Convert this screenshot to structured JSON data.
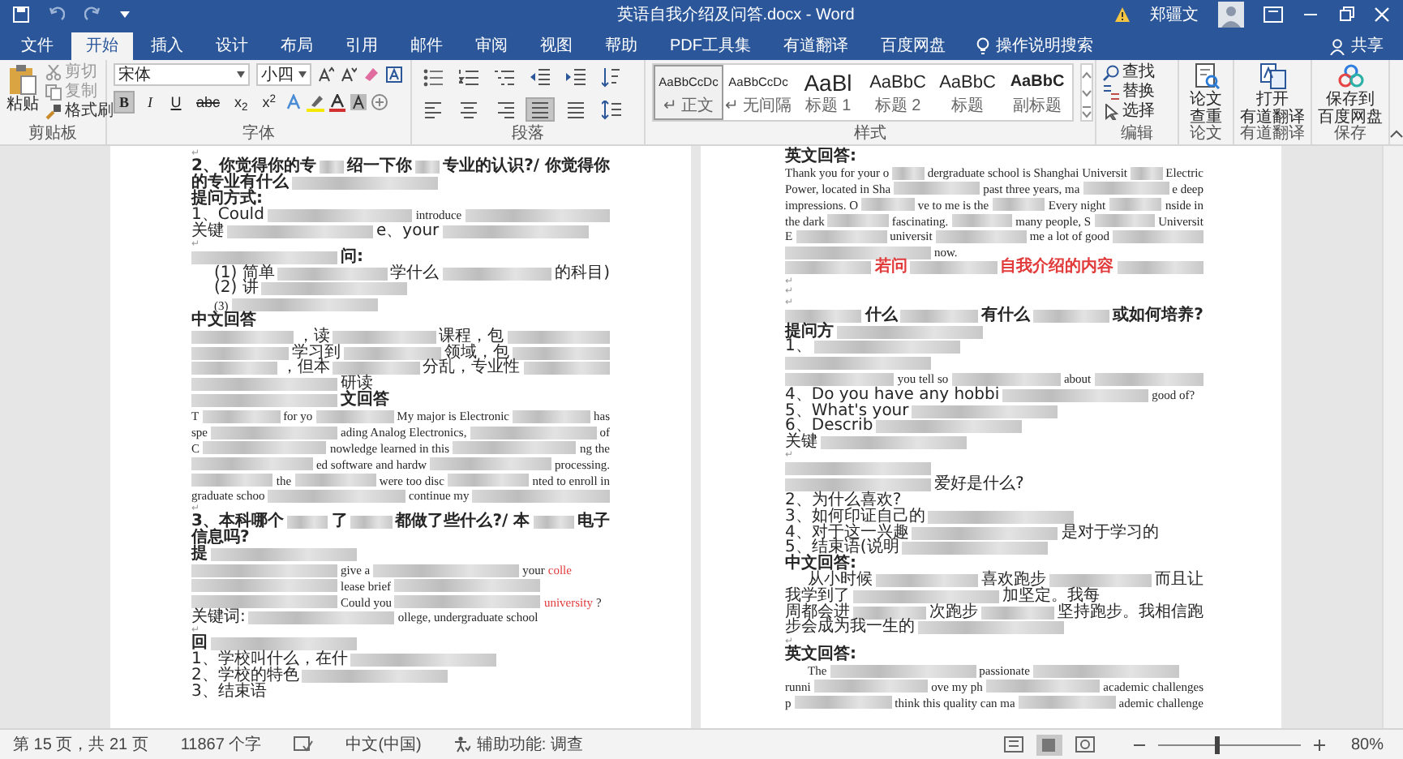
{
  "title_bar": {
    "title": "英语自我介绍及问答.docx - Word",
    "user": "郑疆文"
  },
  "tabs": [
    {
      "label": "文件",
      "selected": false
    },
    {
      "label": "开始",
      "selected": true
    },
    {
      "label": "插入",
      "selected": false
    },
    {
      "label": "设计",
      "selected": false
    },
    {
      "label": "布局",
      "selected": false
    },
    {
      "label": "引用",
      "selected": false
    },
    {
      "label": "邮件",
      "selected": false
    },
    {
      "label": "审阅",
      "selected": false
    },
    {
      "label": "视图",
      "selected": false
    },
    {
      "label": "帮助",
      "selected": false
    },
    {
      "label": "PDF工具集",
      "selected": false
    },
    {
      "label": "有道翻译",
      "selected": false
    },
    {
      "label": "百度网盘",
      "selected": false
    }
  ],
  "tell_me": "操作说明搜索",
  "share": "共享",
  "clipboard": {
    "paste": "粘贴",
    "cut": "剪切",
    "copy": "复制",
    "format_painter": "格式刷",
    "label": "剪贴板"
  },
  "font": {
    "label": "字体",
    "font_name": "宋体",
    "font_size": "小四",
    "buttons": [
      {
        "text": "B",
        "selected": true
      },
      {
        "text": "I",
        "selected": false
      },
      {
        "text": "U",
        "selected": false
      },
      {
        "text": "abc",
        "selected": false
      },
      {
        "text": "x$_{2}$",
        "selected": false
      },
      {
        "text": "x$^{2}$",
        "selected": false
      }
    ]
  },
  "paragraph": {
    "label": "段落",
    "buttons": [
      {
        "kind": "bullets",
        "selected": false
      },
      {
        "kind": "numbering",
        "selected": false
      },
      {
        "kind": "multilevel",
        "selected": false
      },
      {
        "kind": "outdent",
        "selected": false
      },
      {
        "kind": "indent",
        "selected": false
      },
      {
        "kind": "sort",
        "selected": false
      },
      {
        "kind": "align-left",
        "selected": false
      },
      {
        "kind": "center",
        "selected": false
      },
      {
        "kind": "align-right",
        "selected": false
      },
      {
        "kind": "justify",
        "selected": true
      },
      {
        "kind": "distributed",
        "selected": false
      },
      {
        "kind": "line-spacing",
        "selected": false
      }
    ]
  },
  "styles": {
    "label": "样式",
    "items": [
      {
        "preview": "AaBbCcDc",
        "name": "↵ 正文",
        "kind": "normal",
        "selected": true
      },
      {
        "preview": "AaBbCcDc",
        "name": "↵ 无间隔",
        "kind": "normal",
        "selected": false
      },
      {
        "preview": "AaBl",
        "name": "标题 1",
        "kind": "large",
        "selected": false
      },
      {
        "preview": "AaBbC",
        "name": "标题 2",
        "kind": "medium",
        "selected": false
      },
      {
        "preview": "AaBbC",
        "name": "标题",
        "kind": "medium",
        "selected": false
      },
      {
        "preview": "AaBbC",
        "name": "副标题",
        "kind": "bold",
        "selected": false
      }
    ]
  },
  "editing": {
    "label": "编辑",
    "find": "查找",
    "replace": "替换",
    "select": "选择"
  },
  "paper": {
    "label": "论文",
    "button": [
      "论文",
      "查重"
    ]
  },
  "youdao": {
    "label": "有道翻译",
    "button": [
      "打开",
      "有道翻译"
    ]
  },
  "save": {
    "label": "保存",
    "button": [
      "保存到",
      "百度网盘"
    ]
  },
  "pages": [
    {
      "lines": [
        {
          "kind": "mark",
          "parts": [
            {
              "kind": "text",
              "text": "↵"
            }
          ]
        },
        {
          "kind": "heading",
          "parts": [
            {
              "kind": "text",
              "text": "2、你觉得你的专"
            },
            {
              "kind": "blur"
            },
            {
              "kind": "text",
              "text": "绍一下你"
            },
            {
              "kind": "blur"
            },
            {
              "kind": "text",
              "text": "专业的认识?/ 你觉得你"
            }
          ]
        },
        {
          "kind": "heading",
          "parts": [
            {
              "kind": "text",
              "text": "的专业有什么"
            },
            {
              "kind": "blur"
            }
          ]
        },
        {
          "kind": "heading",
          "parts": [
            {
              "kind": "text",
              "text": "提问方式:"
            }
          ]
        },
        {
          "kind": "body",
          "parts": [
            {
              "kind": "text",
              "text": "1、Could"
            },
            {
              "kind": "blur"
            },
            {
              "kind": "text",
              "text": "introduce"
            },
            {
              "kind": "blur"
            }
          ]
        },
        {
          "kind": "body",
          "parts": [
            {
              "kind": "text",
              "text": "关键"
            },
            {
              "kind": "blur"
            },
            {
              "kind": "text",
              "text": "e、your"
            },
            {
              "kind": "blur"
            }
          ]
        },
        {
          "kind": "mark",
          "parts": [
            {
              "kind": "text",
              "text": "↵"
            }
          ]
        },
        {
          "kind": "heading",
          "parts": [
            {
              "kind": "blur"
            },
            {
              "kind": "text",
              "text": "问:"
            }
          ]
        },
        {
          "kind": "indented",
          "parts": [
            {
              "kind": "text",
              "text": "(1) 简单"
            },
            {
              "kind": "blur"
            },
            {
              "kind": "text",
              "text": "学什么"
            },
            {
              "kind": "blur"
            },
            {
              "kind": "text",
              "text": "的科目)"
            }
          ]
        },
        {
          "kind": "indented",
          "parts": [
            {
              "kind": "text",
              "text": "(2) 讲"
            },
            {
              "kind": "blur"
            }
          ]
        },
        {
          "kind": "indented",
          "parts": [
            {
              "kind": "text",
              "text": "(3)"
            },
            {
              "kind": "blur"
            }
          ]
        },
        {
          "kind": "heading",
          "parts": [
            {
              "kind": "text",
              "text": "中文回答"
            }
          ]
        },
        {
          "kind": "body",
          "parts": [
            {
              "kind": "blur"
            },
            {
              "kind": "text",
              "text": "，读"
            },
            {
              "kind": "blur"
            },
            {
              "kind": "text",
              "text": "课程，包"
            },
            {
              "kind": "blur"
            }
          ]
        },
        {
          "kind": "body",
          "parts": [
            {
              "kind": "blur"
            },
            {
              "kind": "text",
              "text": "学习到"
            },
            {
              "kind": "blur"
            },
            {
              "kind": "text",
              "text": "领域，包"
            },
            {
              "kind": "blur"
            }
          ]
        },
        {
          "kind": "body",
          "parts": [
            {
              "kind": "blur"
            },
            {
              "kind": "text",
              "text": "，但本"
            },
            {
              "kind": "blur"
            },
            {
              "kind": "text",
              "text": "分乱，专业性"
            },
            {
              "kind": "blur"
            }
          ]
        },
        {
          "kind": "body",
          "parts": [
            {
              "kind": "blur"
            },
            {
              "kind": "text",
              "text": "研读"
            }
          ]
        },
        {
          "kind": "heading",
          "parts": [
            {
              "kind": "blur"
            },
            {
              "kind": "text",
              "text": "文回答"
            }
          ]
        },
        {
          "kind": "body",
          "parts": [
            {
              "kind": "text",
              "text": "T"
            },
            {
              "kind": "blur"
            },
            {
              "kind": "text",
              "text": "for yo"
            },
            {
              "kind": "blur"
            },
            {
              "kind": "text",
              "text": "My major is Electronic"
            },
            {
              "kind": "blur"
            },
            {
              "kind": "text",
              "text": "has"
            }
          ]
        },
        {
          "kind": "body",
          "parts": [
            {
              "kind": "text",
              "text": "spe"
            },
            {
              "kind": "blur"
            },
            {
              "kind": "text",
              "text": "ading Analog Electronics,"
            },
            {
              "kind": "blur"
            },
            {
              "kind": "text",
              "text": "of"
            }
          ]
        },
        {
          "kind": "body",
          "parts": [
            {
              "kind": "text",
              "text": "C"
            },
            {
              "kind": "blur"
            },
            {
              "kind": "text",
              "text": "nowledge learned in this"
            },
            {
              "kind": "blur"
            },
            {
              "kind": "text",
              "text": "ng the"
            }
          ]
        },
        {
          "kind": "body",
          "parts": [
            {
              "kind": "blur"
            },
            {
              "kind": "text",
              "text": "ed software and hardw"
            },
            {
              "kind": "blur"
            },
            {
              "kind": "text",
              "text": "processing."
            }
          ]
        },
        {
          "kind": "body",
          "parts": [
            {
              "kind": "blur"
            },
            {
              "kind": "text",
              "text": "the"
            },
            {
              "kind": "blur"
            },
            {
              "kind": "text",
              "text": "were too disc"
            },
            {
              "kind": "blur"
            },
            {
              "kind": "text",
              "text": "nted to enroll in"
            }
          ]
        },
        {
          "kind": "body",
          "parts": [
            {
              "kind": "text",
              "text": "graduate schoo"
            },
            {
              "kind": "blur"
            },
            {
              "kind": "text",
              "text": "continue my"
            },
            {
              "kind": "blur"
            }
          ]
        },
        {
          "kind": "mark",
          "parts": [
            {
              "kind": "text",
              "text": "↵"
            }
          ]
        },
        {
          "kind": "heading",
          "parts": [
            {
              "kind": "text",
              "text": "3、本科哪个"
            },
            {
              "kind": "blur"
            },
            {
              "kind": "text",
              "text": "了"
            },
            {
              "kind": "blur"
            },
            {
              "kind": "text",
              "text": "都做了些什么?/ 本"
            },
            {
              "kind": "blur"
            },
            {
              "kind": "text",
              "text": "电子"
            }
          ]
        },
        {
          "kind": "heading",
          "parts": [
            {
              "kind": "text",
              "text": "信息吗?"
            }
          ]
        },
        {
          "kind": "heading",
          "parts": [
            {
              "kind": "text",
              "text": "提"
            },
            {
              "kind": "blur"
            }
          ]
        },
        {
          "kind": "body",
          "parts": [
            {
              "kind": "blur"
            },
            {
              "kind": "text",
              "text": "give a"
            },
            {
              "kind": "blur"
            },
            {
              "kind": "text",
              "text": "your"
            },
            {
              "kind": "red",
              "text": "colle"
            }
          ]
        },
        {
          "kind": "body",
          "parts": [
            {
              "kind": "blur"
            },
            {
              "kind": "text",
              "text": "lease brief"
            },
            {
              "kind": "blur"
            }
          ]
        },
        {
          "kind": "body",
          "parts": [
            {
              "kind": "blur"
            },
            {
              "kind": "text",
              "text": "Could you"
            },
            {
              "kind": "blur"
            },
            {
              "kind": "red",
              "text": "university"
            },
            {
              "kind": "text",
              "text": "?"
            }
          ]
        },
        {
          "kind": "body",
          "parts": [
            {
              "kind": "text",
              "text": "关键词:"
            },
            {
              "kind": "blur"
            },
            {
              "kind": "text",
              "text": "ollege, undergraduate school"
            }
          ]
        },
        {
          "kind": "mark",
          "parts": [
            {
              "kind": "text",
              "text": "↵"
            }
          ]
        },
        {
          "kind": "heading",
          "parts": [
            {
              "kind": "text",
              "text": "回"
            },
            {
              "kind": "blur"
            }
          ]
        },
        {
          "kind": "body",
          "parts": [
            {
              "kind": "text",
              "text": "1、学校叫什么，在什"
            },
            {
              "kind": "blur"
            }
          ]
        },
        {
          "kind": "body",
          "parts": [
            {
              "kind": "text",
              "text": "2、学校的特色"
            },
            {
              "kind": "blur"
            }
          ]
        },
        {
          "kind": "body",
          "parts": [
            {
              "kind": "text",
              "text": "3、结束语"
            }
          ]
        }
      ]
    },
    {
      "lines": [
        {
          "kind": "heading",
          "parts": [
            {
              "kind": "text",
              "text": "英文回答:"
            }
          ]
        },
        {
          "kind": "body",
          "parts": [
            {
              "kind": "text",
              "text": "Thank you for your o"
            },
            {
              "kind": "blur"
            },
            {
              "kind": "text",
              "text": "dergraduate school is Shanghai Universit"
            },
            {
              "kind": "blur"
            },
            {
              "kind": "text",
              "text": "Electric"
            }
          ]
        },
        {
          "kind": "body",
          "parts": [
            {
              "kind": "text",
              "text": "Power, located in Sha"
            },
            {
              "kind": "blur"
            },
            {
              "kind": "text",
              "text": "past three years, ma"
            },
            {
              "kind": "blur"
            },
            {
              "kind": "text",
              "text": "e deep"
            }
          ]
        },
        {
          "kind": "body",
          "parts": [
            {
              "kind": "text",
              "text": "impressions. O"
            },
            {
              "kind": "blur"
            },
            {
              "kind": "text",
              "text": "ve to me is the"
            },
            {
              "kind": "blur"
            },
            {
              "kind": "text",
              "text": "Every night"
            },
            {
              "kind": "blur"
            },
            {
              "kind": "text",
              "text": "nside in"
            }
          ]
        },
        {
          "kind": "body",
          "parts": [
            {
              "kind": "text",
              "text": "the dark"
            },
            {
              "kind": "blur"
            },
            {
              "kind": "text",
              "text": "fascinating."
            },
            {
              "kind": "blur"
            },
            {
              "kind": "text",
              "text": "many people, S"
            },
            {
              "kind": "blur"
            },
            {
              "kind": "text",
              "text": "Universit"
            }
          ]
        },
        {
          "kind": "body",
          "parts": [
            {
              "kind": "text",
              "text": "E"
            },
            {
              "kind": "blur"
            },
            {
              "kind": "text",
              "text": "universit"
            },
            {
              "kind": "blur"
            },
            {
              "kind": "text",
              "text": "me a lot of good"
            },
            {
              "kind": "blur"
            }
          ]
        },
        {
          "kind": "body",
          "parts": [
            {
              "kind": "blur"
            },
            {
              "kind": "text",
              "text": "now."
            }
          ]
        },
        {
          "kind": "heading",
          "parts": [
            {
              "kind": "blur"
            },
            {
              "kind": "red",
              "text": "若问"
            },
            {
              "kind": "blur"
            },
            {
              "kind": "red",
              "text": "自我介绍的内容"
            },
            {
              "kind": "blur"
            }
          ]
        },
        {
          "kind": "mark",
          "parts": [
            {
              "kind": "text",
              "text": "↵"
            }
          ]
        },
        {
          "kind": "mark",
          "parts": [
            {
              "kind": "text",
              "text": "↵"
            }
          ]
        },
        {
          "kind": "mark",
          "parts": [
            {
              "kind": "text",
              "text": "↵"
            }
          ]
        },
        {
          "kind": "heading",
          "parts": [
            {
              "kind": "blur"
            },
            {
              "kind": "text",
              "text": "什么"
            },
            {
              "kind": "blur"
            },
            {
              "kind": "text",
              "text": "有什么"
            },
            {
              "kind": "blur"
            },
            {
              "kind": "text",
              "text": "或如何培养?"
            }
          ]
        },
        {
          "kind": "heading",
          "parts": [
            {
              "kind": "text",
              "text": "提问方"
            },
            {
              "kind": "blur"
            }
          ]
        },
        {
          "kind": "body",
          "parts": [
            {
              "kind": "text",
              "text": "1、"
            },
            {
              "kind": "blur"
            }
          ]
        },
        {
          "kind": "body",
          "parts": [
            {
              "kind": "blur"
            }
          ]
        },
        {
          "kind": "body",
          "parts": [
            {
              "kind": "blur"
            },
            {
              "kind": "text",
              "text": "you tell so"
            },
            {
              "kind": "blur"
            },
            {
              "kind": "text",
              "text": "about"
            },
            {
              "kind": "blur"
            }
          ]
        },
        {
          "kind": "body",
          "parts": [
            {
              "kind": "text",
              "text": "4、Do you have any hobbi"
            },
            {
              "kind": "blur"
            },
            {
              "kind": "text",
              "text": "good of?"
            }
          ]
        },
        {
          "kind": "body",
          "parts": [
            {
              "kind": "text",
              "text": "5、What's your"
            },
            {
              "kind": "blur"
            }
          ]
        },
        {
          "kind": "body",
          "parts": [
            {
              "kind": "text",
              "text": "6、Describ"
            },
            {
              "kind": "blur"
            }
          ]
        },
        {
          "kind": "body",
          "parts": [
            {
              "kind": "text",
              "text": "关键"
            },
            {
              "kind": "blur"
            }
          ]
        },
        {
          "kind": "mark",
          "parts": [
            {
              "kind": "text",
              "text": "↵"
            }
          ]
        },
        {
          "kind": "heading",
          "parts": [
            {
              "kind": "blur"
            }
          ]
        },
        {
          "kind": "body",
          "parts": [
            {
              "kind": "blur"
            },
            {
              "kind": "text",
              "text": "爱好是什么?"
            }
          ]
        },
        {
          "kind": "body",
          "parts": [
            {
              "kind": "text",
              "text": "2、为什么喜欢?"
            }
          ]
        },
        {
          "kind": "body",
          "parts": [
            {
              "kind": "text",
              "text": "3、如何印证自己的"
            },
            {
              "kind": "blur"
            }
          ]
        },
        {
          "kind": "body",
          "parts": [
            {
              "kind": "text",
              "text": "4、对于这一兴趣"
            },
            {
              "kind": "blur"
            },
            {
              "kind": "text",
              "text": "是对于学习的"
            }
          ]
        },
        {
          "kind": "body",
          "parts": [
            {
              "kind": "text",
              "text": "5、结束语(说明"
            },
            {
              "kind": "blur"
            }
          ]
        },
        {
          "kind": "heading",
          "parts": [
            {
              "kind": "text",
              "text": "中文回答:"
            }
          ]
        },
        {
          "kind": "indented",
          "parts": [
            {
              "kind": "text",
              "text": "从小时候"
            },
            {
              "kind": "blur"
            },
            {
              "kind": "text",
              "text": "喜欢跑步"
            },
            {
              "kind": "blur"
            },
            {
              "kind": "text",
              "text": "而且让"
            }
          ]
        },
        {
          "kind": "body",
          "parts": [
            {
              "kind": "text",
              "text": "我学到了"
            },
            {
              "kind": "blur"
            },
            {
              "kind": "text",
              "text": "加坚定。我每"
            }
          ]
        },
        {
          "kind": "body",
          "parts": [
            {
              "kind": "text",
              "text": "周都会进"
            },
            {
              "kind": "blur"
            },
            {
              "kind": "text",
              "text": "次跑步"
            },
            {
              "kind": "blur"
            },
            {
              "kind": "text",
              "text": "坚持跑步。我相信跑"
            }
          ]
        },
        {
          "kind": "body",
          "parts": [
            {
              "kind": "text",
              "text": "步会成为我一生的"
            },
            {
              "kind": "blur"
            }
          ]
        },
        {
          "kind": "mark",
          "parts": [
            {
              "kind": "text",
              "text": "↵"
            }
          ]
        },
        {
          "kind": "heading",
          "parts": [
            {
              "kind": "text",
              "text": "英文回答:"
            }
          ]
        },
        {
          "kind": "indented",
          "parts": [
            {
              "kind": "text",
              "text": "The"
            },
            {
              "kind": "blur"
            },
            {
              "kind": "text",
              "text": "passionate"
            },
            {
              "kind": "blur"
            }
          ]
        },
        {
          "kind": "body",
          "parts": [
            {
              "kind": "text",
              "text": "runni"
            },
            {
              "kind": "blur"
            },
            {
              "kind": "text",
              "text": "ove my ph"
            },
            {
              "kind": "blur"
            },
            {
              "kind": "text",
              "text": "academic challenges"
            }
          ]
        },
        {
          "kind": "body",
          "parts": [
            {
              "kind": "text",
              "text": "p"
            },
            {
              "kind": "blur"
            },
            {
              "kind": "text",
              "text": "think this quality can ma"
            },
            {
              "kind": "blur"
            },
            {
              "kind": "text",
              "text": "ademic challenge"
            }
          ]
        }
      ]
    }
  ],
  "status_bar": {
    "page": "第 15 页，共 21 页",
    "words": "11867 个字",
    "language": "中文(中国)",
    "accessibility": "辅助功能: 调查",
    "zoom": {
      "level": 0.42,
      "reading": "80%"
    }
  }
}
